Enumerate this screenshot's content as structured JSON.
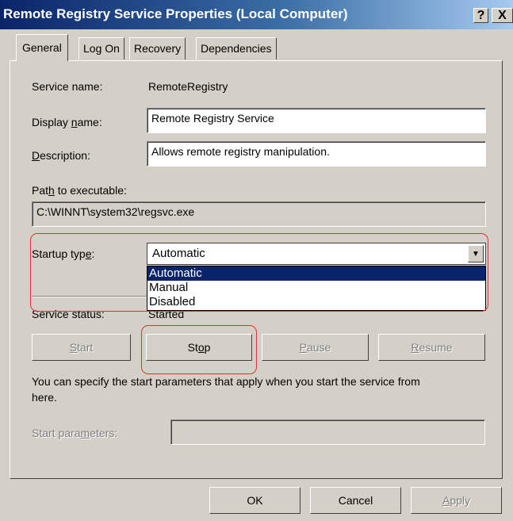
{
  "window": {
    "title": "Remote Registry Service Properties (Local Computer)",
    "help_glyph": "?",
    "close_glyph": "X"
  },
  "tabs": [
    {
      "label": "General",
      "active": true
    },
    {
      "label": "Log On",
      "active": false
    },
    {
      "label": "Recovery",
      "active": false
    },
    {
      "label": "Dependencies",
      "active": false
    }
  ],
  "general": {
    "service_name_label": "Service name:",
    "service_name_value": "RemoteRegistry",
    "display_name_label_pre": "Display ",
    "display_name_label_u": "n",
    "display_name_label_post": "ame:",
    "display_name_value": "Remote Registry Service",
    "description_label_u": "D",
    "description_label_post": "escription:",
    "description_value": "Allows remote registry manipulation.",
    "path_label_pre": "Pat",
    "path_label_u": "h",
    "path_label_post": " to executable:",
    "path_value": "C:\\WINNT\\system32\\regsvc.exe",
    "startup_label_pre": "Startup typ",
    "startup_label_u": "e",
    "startup_label_post": ":",
    "startup_selected": "Automatic",
    "startup_options": [
      "Automatic",
      "Manual",
      "Disabled"
    ],
    "status_label": "Service status:",
    "status_value": "Started",
    "buttons": {
      "start_u": "S",
      "start_post": "tart",
      "stop_pre": "St",
      "stop_u": "o",
      "stop_post": "p",
      "pause_u": "P",
      "pause_post": "ause",
      "resume_u": "R",
      "resume_post": "esume"
    },
    "hint_line1": "You can specify the start parameters that apply when you start the service from",
    "hint_line2": "here.",
    "params_label_pre": "Start para",
    "params_label_u": "m",
    "params_label_post": "eters:",
    "params_value": ""
  },
  "footer": {
    "ok": "OK",
    "cancel": "Cancel",
    "apply_u": "A",
    "apply_post": "pply"
  },
  "colors": {
    "title_start": "#0a246a",
    "title_end": "#a6caf0",
    "highlight": "#0a246a",
    "annotation": "#e03030",
    "face": "#d4d0c8"
  }
}
